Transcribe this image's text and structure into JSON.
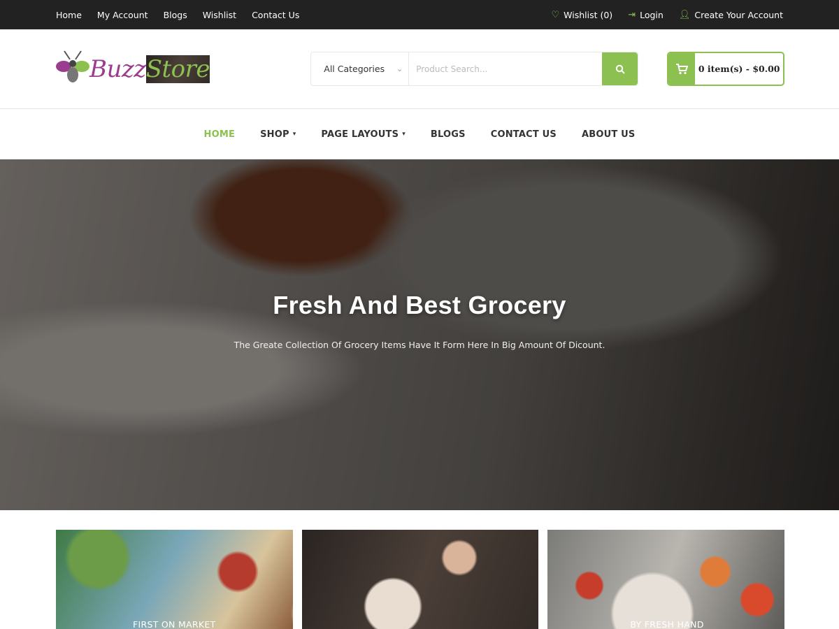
{
  "topbar": {
    "links": [
      "Home",
      "My Account",
      "Blogs",
      "Wishlist",
      "Contact Us"
    ],
    "wishlist": "Wishlist (0)",
    "login": "Login",
    "create_account": "Create Your Account"
  },
  "brand": {
    "name_part1": "Buzz",
    "name_part2": "Store"
  },
  "search": {
    "category": "All Categories",
    "placeholder": "Product Search..."
  },
  "cart": {
    "label": "0 item(s) - $0.00"
  },
  "nav": {
    "items": [
      "HOME",
      "SHOP",
      "PAGE LAYOUTS",
      "BLOGS",
      "CONTACT US",
      "ABOUT US"
    ],
    "active": "HOME"
  },
  "hero": {
    "title": "Fresh And Best Grocery",
    "subtitle": "The Greate Collection Of Grocery Items Have It Form Here In Big Amount Of Dicount."
  },
  "banners": [
    {
      "caption": "FIRST ON MARKET"
    },
    {
      "caption": ""
    },
    {
      "caption": "BY FRESH HAND"
    }
  ],
  "colors": {
    "accent": "#8cc152",
    "brand_purple": "#9b3d8f",
    "topbar": "#222222"
  }
}
